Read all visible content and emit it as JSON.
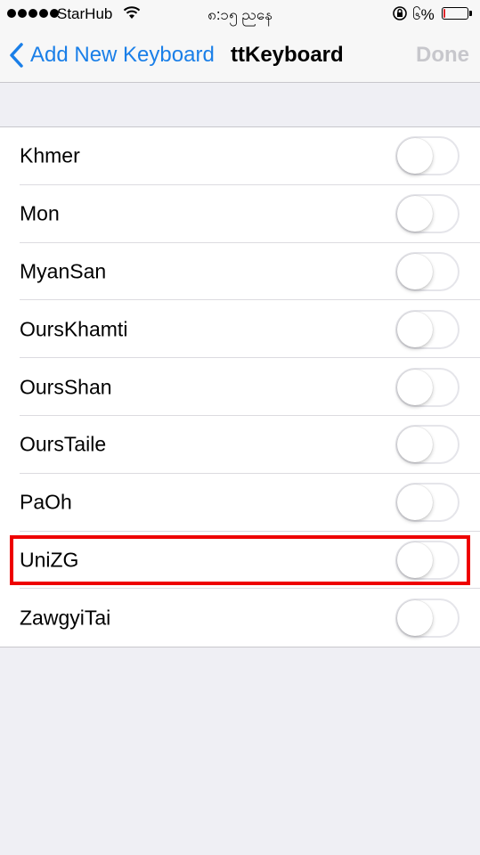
{
  "status_bar": {
    "carrier": "StarHub",
    "time": "၈:၁၅ ညနေ",
    "battery_percent": "၆%",
    "battery_level": 0.06,
    "icons": [
      "signal-dots-icon",
      "wifi-icon",
      "orientation-lock-icon",
      "battery-icon"
    ]
  },
  "nav": {
    "back_label": "Add New Keyboard",
    "title": "ttKeyboard",
    "done_label": "Done"
  },
  "keyboards": [
    {
      "label": "Khmer",
      "enabled": false
    },
    {
      "label": "Mon",
      "enabled": false
    },
    {
      "label": "MyanSan",
      "enabled": false
    },
    {
      "label": "OursKhamti",
      "enabled": false
    },
    {
      "label": "OursShan",
      "enabled": false
    },
    {
      "label": "OursTaile",
      "enabled": false
    },
    {
      "label": "PaOh",
      "enabled": false
    },
    {
      "label": "UniZG",
      "enabled": false,
      "highlighted": true
    },
    {
      "label": "ZawgyiTai",
      "enabled": false
    }
  ],
  "colors": {
    "accent": "#1a7fe8",
    "highlight": "#ee0000",
    "background": "#efeff4",
    "done_disabled": "#c7c7cc"
  }
}
